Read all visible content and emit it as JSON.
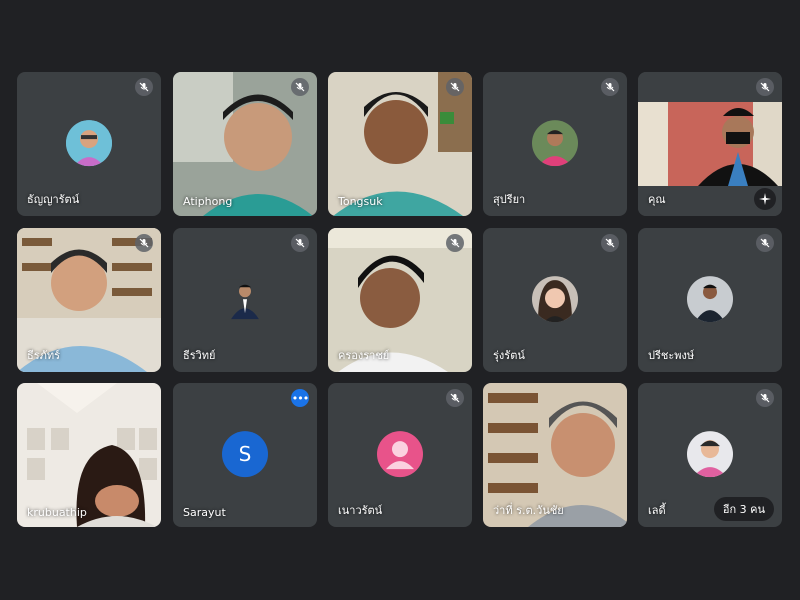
{
  "participants": [
    {
      "name": "ธัญญารัตน์",
      "muted": true
    },
    {
      "name": "Atiphong",
      "muted": true
    },
    {
      "name": "Tongsuk",
      "muted": true
    },
    {
      "name": "สุปรียา",
      "muted": true
    },
    {
      "name": "คุณ",
      "muted": true,
      "effects_icon": "sparkle-icon"
    },
    {
      "name": "ธีรภัทร์",
      "muted": true
    },
    {
      "name": "ธีรวิทย์",
      "muted": true
    },
    {
      "name": "ครองราชย์",
      "muted": true
    },
    {
      "name": "รุ่งรัตน์",
      "muted": true
    },
    {
      "name": "ปรีชะพงษ์",
      "muted": true
    },
    {
      "name": "krubuathip",
      "muted": false
    },
    {
      "name": "Sarayut",
      "avatar_letter": "S",
      "avatar_color": "#1967d2",
      "more_options_icon": "more-horiz-icon"
    },
    {
      "name": "เนาวรัตน์",
      "muted": true,
      "avatar_color": "#e8538a"
    },
    {
      "name": "ว่าที่ ร.ต.วันชัย",
      "muted": true
    },
    {
      "name": "เลดี้",
      "muted": true,
      "others_label": "อีก 3 คน"
    }
  ],
  "colors": {
    "background": "#202124",
    "tile": "#3c4043",
    "mic_badge": "#5f6368",
    "more_badge": "#1a73e8"
  }
}
